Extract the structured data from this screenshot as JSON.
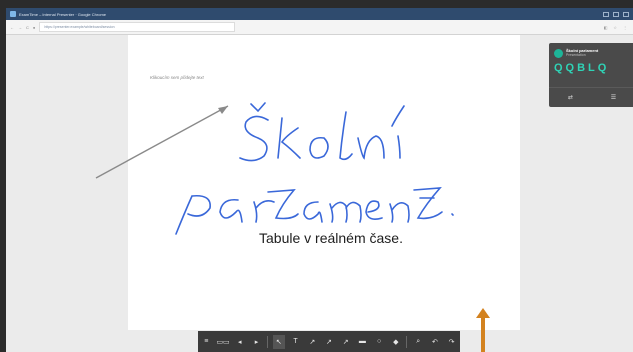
{
  "window": {
    "title": "ExamTime – Internal Presenter · Google Chrome"
  },
  "addressbar": {
    "back": "←",
    "forward": "→",
    "reload": "C",
    "lock": "●",
    "url": "https://presenter.example/whiteboard/session"
  },
  "board": {
    "hint": "Klikoucím sem přidejte text",
    "text": "Tabule v reálném čase.",
    "ink_color": "#3a68d9"
  },
  "session": {
    "title": "Školní parlament",
    "subtitle": "Presentation",
    "code": "QQBLQ",
    "share_icon": "share-icon",
    "list_icon": "list-icon"
  },
  "toolbar": {
    "menu_glyph": "≡",
    "slides_glyph": "▭▭",
    "prev_glyph": "◂",
    "next_glyph": "▸",
    "pointer_glyph": "↖",
    "text_glyph": "T",
    "pen1_glyph": "↗",
    "pen2_glyph": "↗",
    "pen3_glyph": "↗",
    "eraser_glyph": "▬",
    "shape_glyph": "○",
    "fill_glyph": "◆",
    "zoom_glyph": "⌕",
    "undo_glyph": "↶",
    "redo_glyph": "↷"
  },
  "colors": {
    "accent": "#2fd3b6",
    "arrow": "#d3821f"
  }
}
